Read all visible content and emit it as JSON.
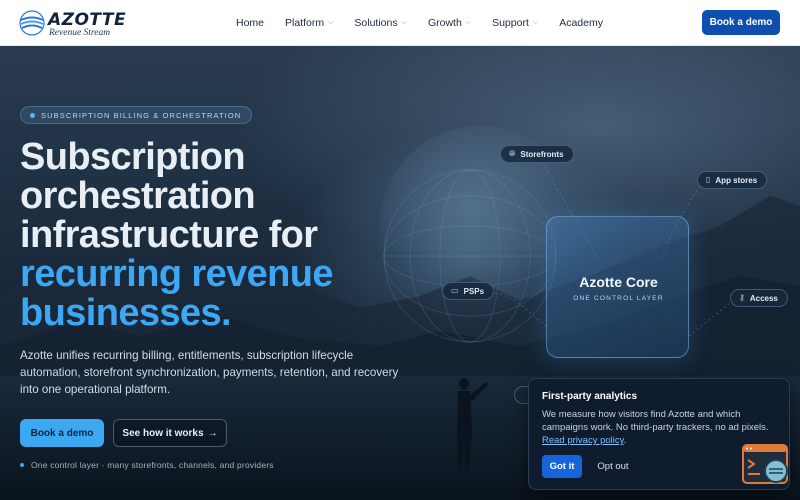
{
  "brand": {
    "name": "AZOTTE",
    "tagline": "Revenue Stream"
  },
  "nav": {
    "items": [
      {
        "label": "Home",
        "dropdown": false
      },
      {
        "label": "Platform",
        "dropdown": true
      },
      {
        "label": "Solutions",
        "dropdown": true
      },
      {
        "label": "Growth",
        "dropdown": true
      },
      {
        "label": "Support",
        "dropdown": true
      },
      {
        "label": "Academy",
        "dropdown": false
      }
    ],
    "cta": "Book a demo"
  },
  "hero": {
    "badge": "SUBSCRIPTION BILLING & ORCHESTRATION",
    "headline_lines": [
      "Subscription",
      "orchestration",
      "infrastructure for"
    ],
    "headline_accent_lines": [
      "recurring revenue",
      "businesses."
    ],
    "lead": "Azotte unifies recurring billing, entitlements, subscription lifecycle automation, storefront synchronization, payments, retention, and recovery into one operational platform.",
    "primary_cta": "Book a demo",
    "secondary_cta": "See how it works",
    "secondary_cta_arrow": "→",
    "footnote": "One control layer · many storefronts, channels, and providers"
  },
  "diagram": {
    "chips": {
      "storefronts": {
        "label": "Storefronts",
        "icon": "globe-icon"
      },
      "app_stores": {
        "label": "App stores",
        "icon": "phone-icon"
      },
      "psps": {
        "label": "PSPs",
        "icon": "card-icon"
      },
      "access": {
        "label": "Access",
        "icon": "key-icon"
      }
    },
    "core": {
      "title": "Azotte Core",
      "subtitle": "ONE CONTROL LAYER"
    }
  },
  "cookie_banner": {
    "title": "First-party analytics",
    "body": "We measure how visitors find Azotte and which campaigns work. No third-party trackers, no ad pixels.",
    "link": "Read privacy policy",
    "link_suffix": ".",
    "accept": "Got it",
    "decline": "Opt out"
  },
  "colors": {
    "brand_blue": "#0d4fb0",
    "accent": "#3ea7f3",
    "header_bg": "#ffffff",
    "hero_dark": "#0c1622"
  }
}
